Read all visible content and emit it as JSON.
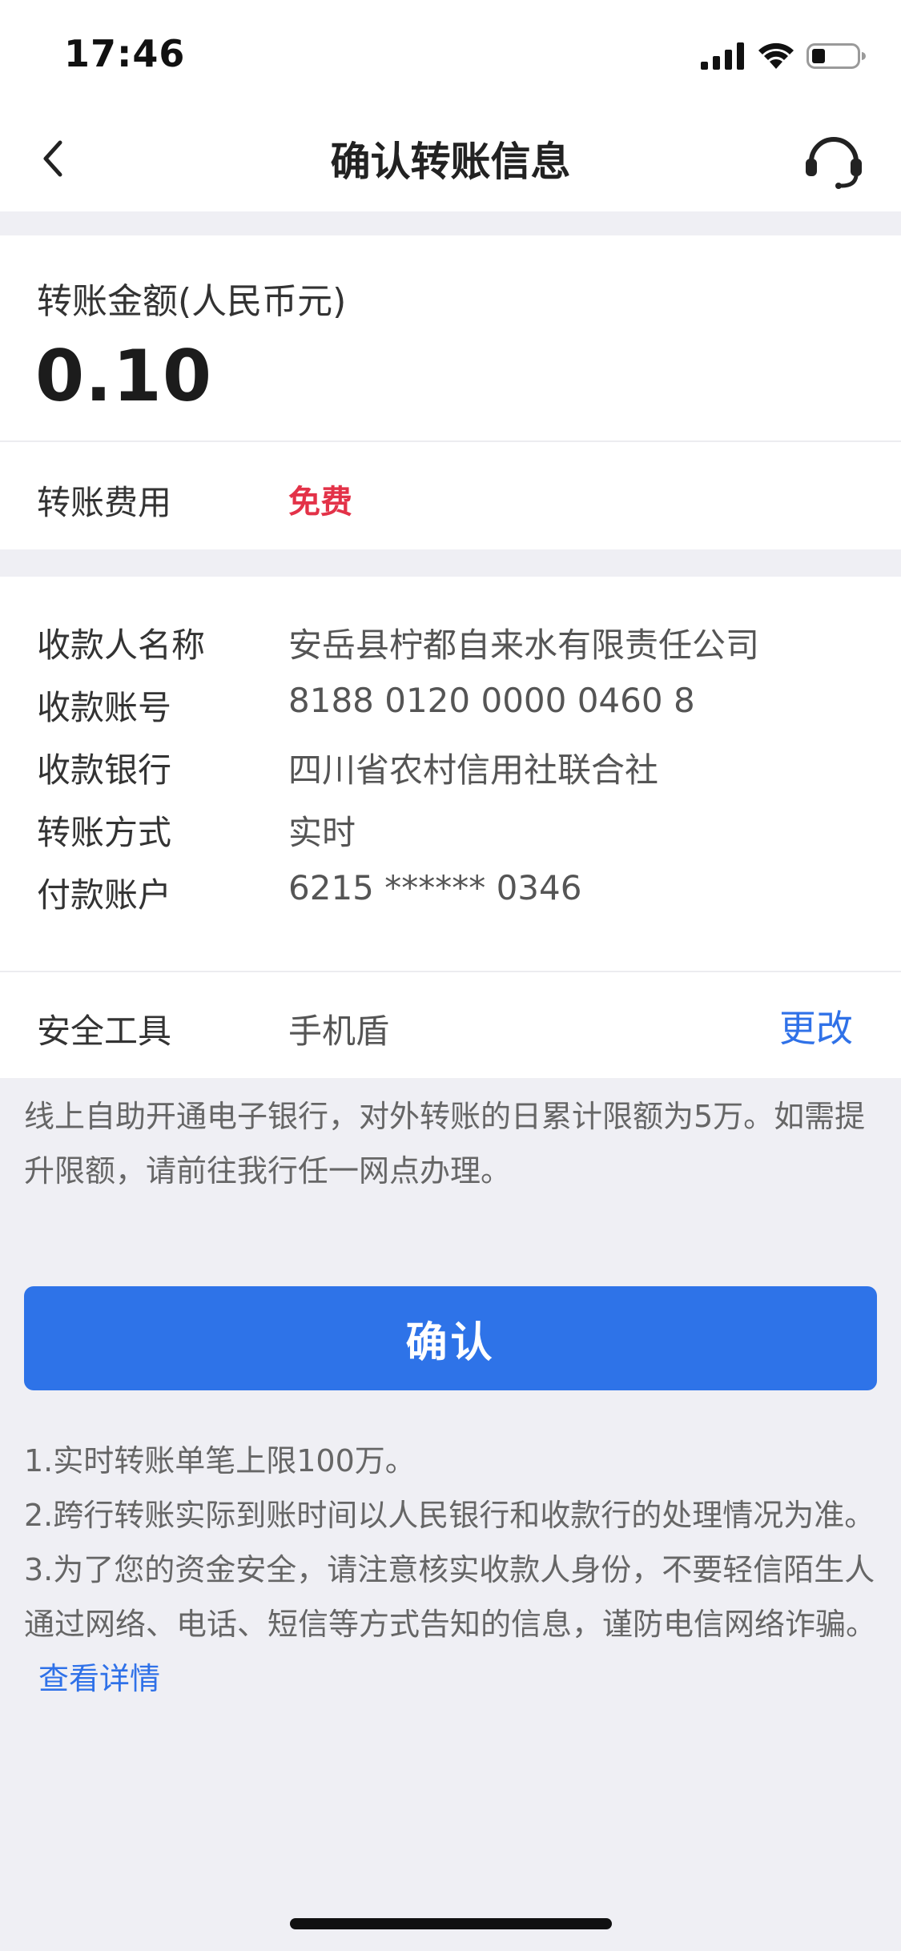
{
  "status_bar": {
    "time": "17:46"
  },
  "nav": {
    "title": "确认转账信息"
  },
  "amount": {
    "label": "转账金额(人民币元)",
    "value": "0.10"
  },
  "fee": {
    "label": "转账费用",
    "value": "免费"
  },
  "details": {
    "rows": [
      {
        "label": "收款人名称",
        "value": "安岳县柠都自来水有限责任公司"
      },
      {
        "label": "收款账号",
        "value": "8188 0120 0000 0460 8"
      },
      {
        "label": "收款银行",
        "value": "四川省农村信用社联合社"
      },
      {
        "label": "转账方式",
        "value": "实时"
      },
      {
        "label": "付款账户",
        "value": "6215 ****** 0346"
      }
    ]
  },
  "security": {
    "label": "安全工具",
    "value": "手机盾",
    "change_label": "更改"
  },
  "notice": "线上自助开通电子银行，对外转账的日累计限额为5万。如需提升限额，请前往我行任一网点办理。",
  "confirm_label": "确认",
  "tips": {
    "line1": "1.实时转账单笔上限100万。",
    "line2": "2.跨行转账实际到账时间以人民银行和收款行的处理情况为准。",
    "line3": "3.为了您的资金安全，请注意核实收款人身份，不要轻信陌生人通过网络、电话、短信等方式告知的信息，谨防电信网络诈骗。",
    "details_link": "查看详情"
  },
  "colors": {
    "accent_blue": "#2e73e8",
    "fee_red": "#e33248",
    "background": "#efeff4"
  }
}
